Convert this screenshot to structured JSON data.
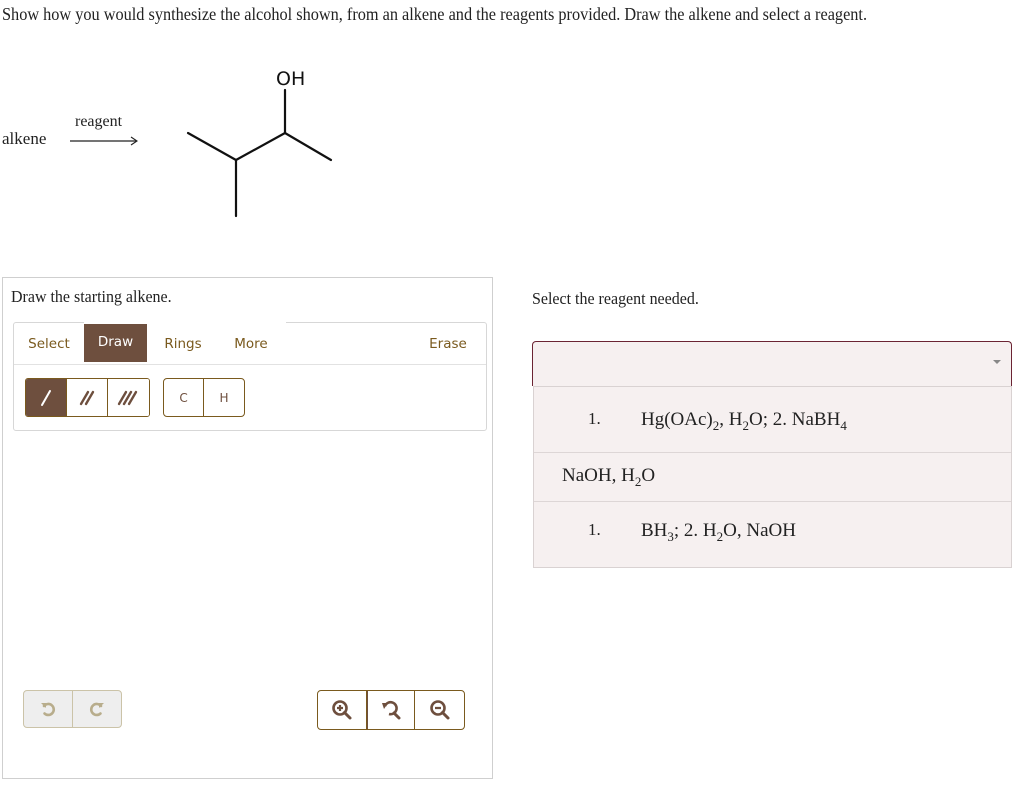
{
  "question": {
    "text": "Show how you would synthesize the alcohol shown, from an alkene and the reagents provided. Draw the alkene and select a reagent."
  },
  "scheme": {
    "reactant_label": "alkene",
    "arrow_label": "reagent",
    "product_label": "OH",
    "product_name": "3-methyl-2-butanol"
  },
  "draw_panel": {
    "title": "Draw the starting alkene.",
    "tabs": [
      {
        "label": "Select",
        "active": false
      },
      {
        "label": "Draw",
        "active": true
      },
      {
        "label": "Rings",
        "active": false
      },
      {
        "label": "More",
        "active": false
      }
    ],
    "erase_label": "Erase",
    "bond_tools": [
      {
        "name": "single-bond",
        "active": true
      },
      {
        "name": "double-bond",
        "active": false
      },
      {
        "name": "triple-bond",
        "active": false
      }
    ],
    "atom_tools": [
      "C",
      "H"
    ],
    "history": [
      "undo",
      "redo"
    ],
    "zoom_tools": [
      "zoom-in",
      "reset-zoom",
      "zoom-out"
    ],
    "colors": {
      "accent": "#6e4f3e",
      "accent_text": "#7a5a1e",
      "disabled_border": "#cbc3a8"
    }
  },
  "reagent_select": {
    "title": "Select the reagent needed.",
    "selected_value": "",
    "border_color": "#6b2433",
    "options": [
      {
        "num": "1.",
        "parts": [
          "Hg(OAc)",
          "2",
          ", H",
          "2",
          "O; 2. NaBH",
          "4"
        ]
      },
      {
        "num": "",
        "parts": [
          "NaOH, H",
          "2",
          "O"
        ]
      },
      {
        "num": "1.",
        "parts": [
          "BH",
          "3",
          "; 2. H",
          "2",
          "O, NaOH"
        ]
      }
    ]
  }
}
